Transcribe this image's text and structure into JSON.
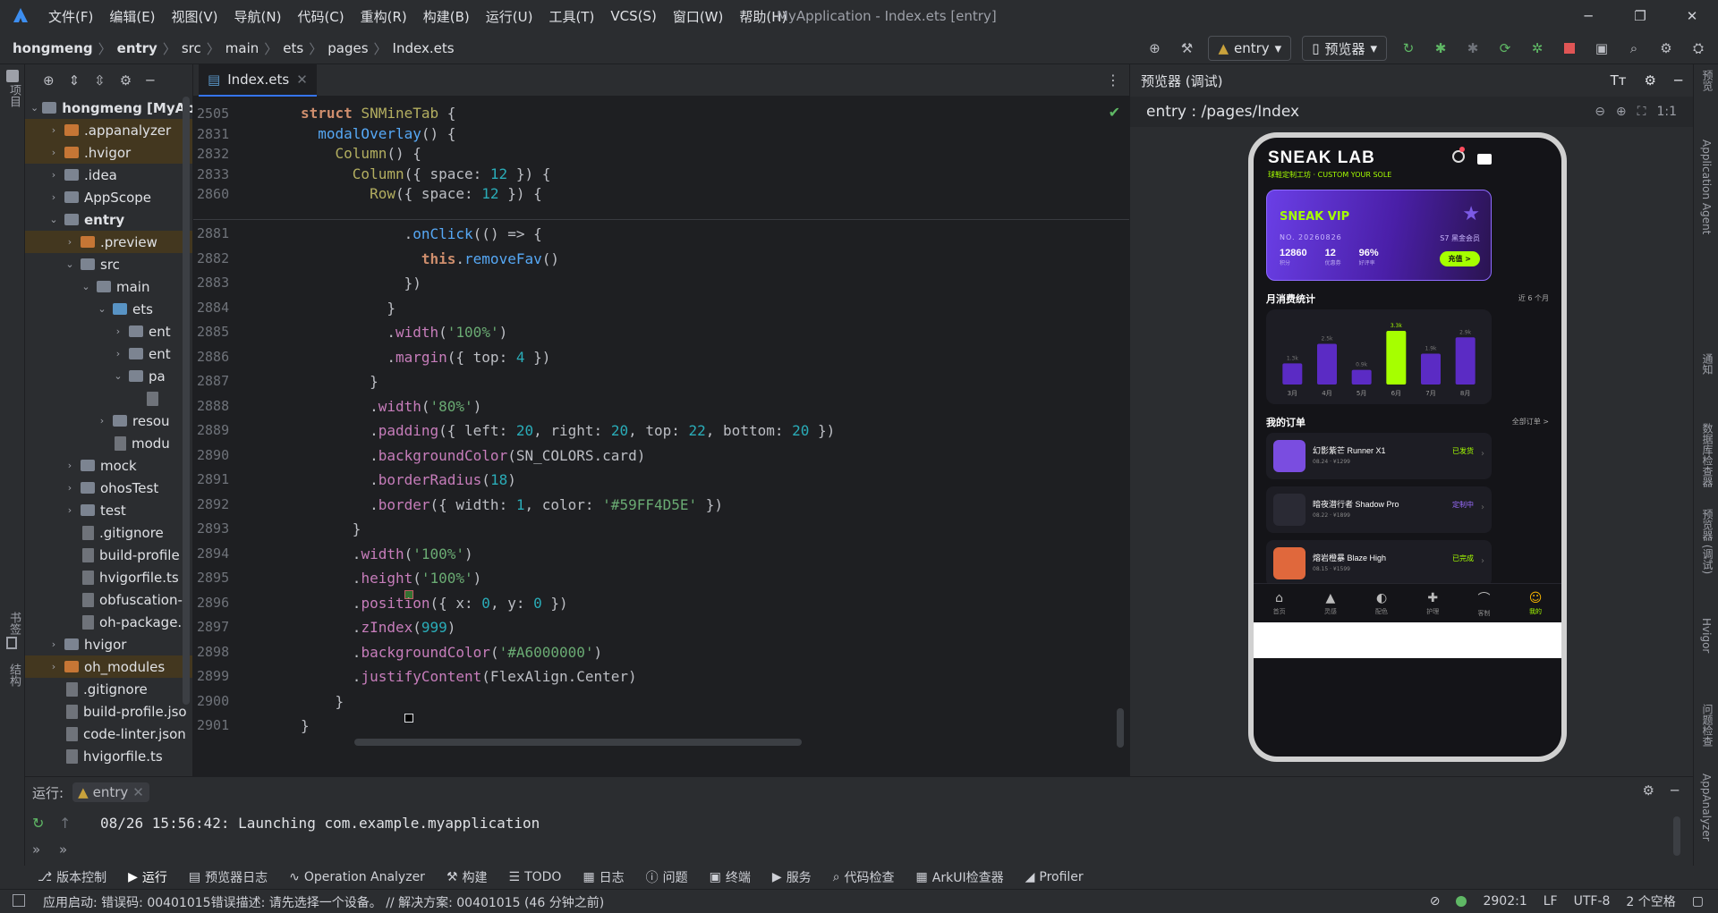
{
  "menu": [
    "文件(F)",
    "编辑(E)",
    "视图(V)",
    "导航(N)",
    "代码(C)",
    "重构(R)",
    "构建(B)",
    "运行(U)",
    "工具(T)",
    "VCS(S)",
    "窗口(W)",
    "帮助(H)"
  ],
  "window_title": "MyApplication - Index.ets [entry]",
  "breadcrumb": [
    "hongmeng",
    "entry",
    "src",
    "main",
    "ets",
    "pages",
    "Index.ets"
  ],
  "toolbar": {
    "run_config": "entry",
    "device": "预览器"
  },
  "left_strip": {
    "project": "项目",
    "bookmarks": "书签",
    "structure": "结构"
  },
  "project_tree": [
    {
      "depth": 0,
      "arrow": "v",
      "icon": "fo-b",
      "label": "hongmeng [MyAp",
      "bold": true
    },
    {
      "depth": 1,
      "arrow": ">",
      "icon": "fo-o",
      "label": ".appanalyzer",
      "hl": true
    },
    {
      "depth": 1,
      "arrow": ">",
      "icon": "fo-o",
      "label": ".hvigor",
      "hl": true
    },
    {
      "depth": 1,
      "arrow": ">",
      "icon": "fo-b",
      "label": ".idea"
    },
    {
      "depth": 1,
      "arrow": ">",
      "icon": "fo-b",
      "label": "AppScope"
    },
    {
      "depth": 1,
      "arrow": "v",
      "icon": "fo-b",
      "label": "entry",
      "bold": true
    },
    {
      "depth": 2,
      "arrow": ">",
      "icon": "fo-o",
      "label": ".preview",
      "hl": true
    },
    {
      "depth": 2,
      "arrow": "v",
      "icon": "fo-b",
      "label": "src"
    },
    {
      "depth": 3,
      "arrow": "v",
      "icon": "fo-b",
      "label": "main"
    },
    {
      "depth": 4,
      "arrow": "v",
      "icon": "fo-s",
      "label": "ets"
    },
    {
      "depth": 5,
      "arrow": ">",
      "icon": "fo-b",
      "label": "ent"
    },
    {
      "depth": 5,
      "arrow": ">",
      "icon": "fo-b",
      "label": "ent"
    },
    {
      "depth": 5,
      "arrow": "v",
      "icon": "fo-b",
      "label": "pa"
    },
    {
      "depth": 6,
      "arrow": "",
      "icon": "fi",
      "label": ""
    },
    {
      "depth": 4,
      "arrow": ">",
      "icon": "fo-b",
      "label": "resou"
    },
    {
      "depth": 4,
      "arrow": "",
      "icon": "fi",
      "label": "modu"
    },
    {
      "depth": 2,
      "arrow": ">",
      "icon": "fo-b",
      "label": "mock"
    },
    {
      "depth": 2,
      "arrow": ">",
      "icon": "fo-b",
      "label": "ohosTest"
    },
    {
      "depth": 2,
      "arrow": ">",
      "icon": "fo-b",
      "label": "test"
    },
    {
      "depth": 2,
      "arrow": "",
      "icon": "fi",
      "label": ".gitignore"
    },
    {
      "depth": 2,
      "arrow": "",
      "icon": "fi",
      "label": "build-profile"
    },
    {
      "depth": 2,
      "arrow": "",
      "icon": "fi",
      "label": "hvigorfile.ts"
    },
    {
      "depth": 2,
      "arrow": "",
      "icon": "fi",
      "label": "obfuscation-"
    },
    {
      "depth": 2,
      "arrow": "",
      "icon": "fi",
      "label": "oh-package."
    },
    {
      "depth": 1,
      "arrow": ">",
      "icon": "fo-b",
      "label": "hvigor"
    },
    {
      "depth": 1,
      "arrow": ">",
      "icon": "fo-o",
      "label": "oh_modules",
      "hl": true
    },
    {
      "depth": 1,
      "arrow": "",
      "icon": "fi",
      "label": ".gitignore"
    },
    {
      "depth": 1,
      "arrow": "",
      "icon": "fi",
      "label": "build-profile.jso"
    },
    {
      "depth": 1,
      "arrow": "",
      "icon": "fi",
      "label": "code-linter.json"
    },
    {
      "depth": 1,
      "arrow": "",
      "icon": "fi",
      "label": "hvigorfile.ts"
    }
  ],
  "editor_tab": "Index.ets",
  "sticky_lines": [
    {
      "n": "2505",
      "h": "<span class='k'>struct</span> <span class='ty'>SNMineTab</span> {"
    },
    {
      "n": "2831",
      "h": "  <span class='fn'>modalOverlay</span>() {"
    },
    {
      "n": "2832",
      "h": "    <span class='ty'>Column</span>() {"
    },
    {
      "n": "2833",
      "h": "      <span class='ty'>Column</span>({ space: <span class='nu'>12</span> }) {"
    },
    {
      "n": "2860",
      "h": "        <span class='ty'>Row</span>({ space: <span class='nu'>12</span> }) {"
    }
  ],
  "code_lines": [
    {
      "n": "2881",
      "h": "            .<span class='fn'>onClick</span>(() => {"
    },
    {
      "n": "2882",
      "h": "              <span class='k'>this</span>.<span class='fn'>removeFav</span>()"
    },
    {
      "n": "2883",
      "h": "            })"
    },
    {
      "n": "2884",
      "h": "          }"
    },
    {
      "n": "2885",
      "h": "          .<span class='pr'>width</span>(<span class='st'>'100%'</span>)"
    },
    {
      "n": "2886",
      "h": "          .<span class='pr'>margin</span>({ top: <span class='nu'>4</span> })"
    },
    {
      "n": "2887",
      "h": "        }"
    },
    {
      "n": "2888",
      "h": "        .<span class='pr'>width</span>(<span class='st'>'80%'</span>)"
    },
    {
      "n": "2889",
      "h": "        .<span class='pr'>padding</span>({ left: <span class='nu'>20</span>, right: <span class='nu'>20</span>, top: <span class='nu'>22</span>, bottom: <span class='nu'>20</span> })"
    },
    {
      "n": "2890",
      "h": "        .<span class='pr'>backgroundColor</span>(SN_COLORS.card)"
    },
    {
      "n": "2891",
      "h": "        .<span class='pr'>borderRadius</span>(<span class='nu'>18</span>)"
    },
    {
      "n": "2892",
      "h": "        .<span class='pr'>border</span>({ width: <span class='nu'>1</span>, color: <span class='st'>'#59FF4D5E'</span> })"
    },
    {
      "n": "2893",
      "h": "      }"
    },
    {
      "n": "2894",
      "h": "      .<span class='pr'>width</span>(<span class='st'>'100%'</span>)"
    },
    {
      "n": "2895",
      "h": "      .<span class='pr'>height</span>(<span class='st'>'100%'</span>)"
    },
    {
      "n": "2896",
      "h": "      .<span class='pr'>position</span>({ x: <span class='nu'>0</span>, y: <span class='nu'>0</span> })"
    },
    {
      "n": "2897",
      "h": "      .<span class='pr'>zIndex</span>(<span class='nu'>999</span>)"
    },
    {
      "n": "2898",
      "h": "      .<span class='pr'>backgroundColor</span>(<span class='st'>'#A6000000'</span>)"
    },
    {
      "n": "2899",
      "h": "      .<span class='pr'>justifyContent</span>(FlexAlign.Center)"
    },
    {
      "n": "2900",
      "h": "    }"
    },
    {
      "n": "2901",
      "h": "}"
    }
  ],
  "preview": {
    "header": "预览器 (调试)",
    "path": "entry : /pages/Index",
    "app": {
      "brand": "SNEAK LAB",
      "tagline": "球鞋定制工坊 · CUSTOM YOUR SOLE",
      "vip_title": "SNEAK VIP",
      "vip_no": "NO. 20260826",
      "vip_level": "S7 黑金会员",
      "stats": [
        {
          "v": "12860",
          "l": "积分"
        },
        {
          "v": "12",
          "l": "优惠券"
        },
        {
          "v": "96%",
          "l": "好评率"
        }
      ],
      "recharge": "充值 >",
      "monthly_title": "月消费统计",
      "monthly_range": "近 6 个月",
      "orders_title": "我的订单",
      "orders_all": "全部订单 >",
      "orders": [
        {
          "name": "幻影紫芒 Runner X1",
          "meta": "08.24 · ¥1299",
          "status": "已发货",
          "sc": "#a6ff00",
          "thumb": "#7a4de0"
        },
        {
          "name": "暗夜潜行者 Shadow Pro",
          "meta": "08.22 · ¥1899",
          "status": "定制中",
          "sc": "#9a6cff",
          "thumb": "#2a2a34"
        },
        {
          "name": "熔岩橙暴 Blaze High",
          "meta": "08.15 · ¥1599",
          "status": "已完成",
          "sc": "#a6ff00",
          "thumb": "#e0683c"
        }
      ],
      "tabs": [
        {
          "icon": "⌂",
          "label": "首页"
        },
        {
          "icon": "▲",
          "label": "灵感"
        },
        {
          "icon": "◐",
          "label": "配色"
        },
        {
          "icon": "✚",
          "label": "护理"
        },
        {
          "icon": "⌒",
          "label": "客制"
        },
        {
          "icon": "☺",
          "label": "我的"
        }
      ]
    }
  },
  "chart_data": {
    "type": "bar",
    "categories": [
      "3月",
      "4月",
      "5月",
      "6月",
      "7月",
      "8月"
    ],
    "values": [
      1.3,
      2.5,
      0.9,
      3.3,
      1.9,
      2.9
    ],
    "value_labels": [
      "1.3k",
      "2.5k",
      "0.9k",
      "3.3k",
      "1.9k",
      "2.9k"
    ],
    "highlight_index": 3,
    "ylim": [
      0,
      3.3
    ],
    "colors": {
      "bar": "#5b2bc4",
      "highlight": "#a6ff00"
    }
  },
  "right_strip": [
    "预览",
    "Application Agent",
    "通知",
    "数据库检查器",
    "预览器 (调试)",
    "Hvigor",
    "问题检查",
    "AppAnalyzer"
  ],
  "run_panel": {
    "label": "运行:",
    "tab": "entry",
    "log": "08/26 15:56:42: Launching com.example.myapplication"
  },
  "tool_windows": [
    "版本控制",
    "运行",
    "预览器日志",
    "Operation Analyzer",
    "构建",
    "TODO",
    "日志",
    "问题",
    "终端",
    "服务",
    "代码检查",
    "ArkUI检查器",
    "Profiler"
  ],
  "status": {
    "message": "应用启动: 错误码: 00401015错误描述: 请先选择一个设备。 // 解决方案: 00401015 (46 分钟之前)",
    "position": "2902:1",
    "eol": "LF",
    "encoding": "UTF-8",
    "indent": "2 个空格"
  }
}
